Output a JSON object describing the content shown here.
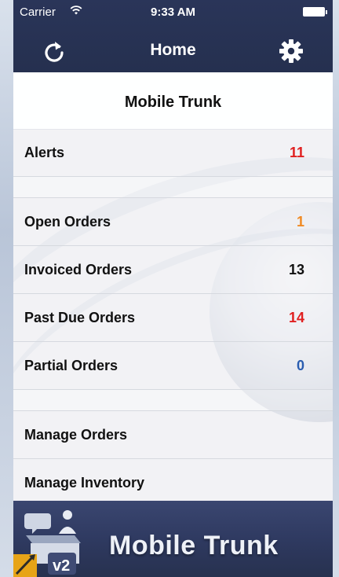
{
  "statusbar": {
    "carrier": "Carrier",
    "time": "9:33 AM"
  },
  "navbar": {
    "title": "Home",
    "left_icon": "refresh-icon",
    "right_icon": "gear-icon"
  },
  "main": {
    "section_title": "Mobile Trunk",
    "groups": [
      {
        "items": [
          {
            "label": "Alerts",
            "value": "11",
            "value_color": "#e02020"
          }
        ]
      },
      {
        "items": [
          {
            "label": "Open Orders",
            "value": "1",
            "value_color": "#f08a24"
          },
          {
            "label": "Invoiced Orders",
            "value": "13",
            "value_color": "#111111"
          },
          {
            "label": "Past Due Orders",
            "value": "14",
            "value_color": "#e02020"
          },
          {
            "label": "Partial Orders",
            "value": "0",
            "value_color": "#2a5db0"
          }
        ]
      },
      {
        "items": [
          {
            "label": "Manage Orders"
          },
          {
            "label": "Manage Inventory"
          }
        ]
      }
    ]
  },
  "footer": {
    "brand": "Mobile Trunk",
    "version_badge": "v2"
  },
  "colors": {
    "header_bg": "#26304f",
    "footer_bg": "#2f3a61",
    "alert_red": "#e02020",
    "orange": "#f08a24",
    "blue": "#2a5db0"
  }
}
